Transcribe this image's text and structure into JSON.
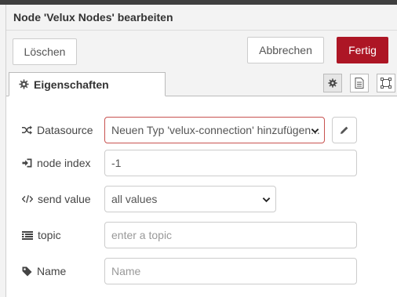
{
  "dialog": {
    "title": "Node 'Velux Nodes' bearbeiten"
  },
  "toolbar": {
    "delete_label": "Löschen",
    "cancel_label": "Abbrechen",
    "done_label": "Fertig"
  },
  "tabs": {
    "properties_label": "Eigenschaften"
  },
  "form": {
    "datasource": {
      "label": "Datasource",
      "value": "Neuen Typ 'velux-connection' hinzufügen..."
    },
    "node_index": {
      "label": "node index",
      "value": "-1"
    },
    "send_value": {
      "label": "send value",
      "value": "all values"
    },
    "topic": {
      "label": "topic",
      "placeholder": "enter a topic"
    },
    "name": {
      "label": "Name",
      "placeholder": "Name"
    }
  },
  "colors": {
    "accent": "#ad1625",
    "invalid_border": "#c85250"
  },
  "icons": [
    "gear-icon",
    "document-icon",
    "frame-icon",
    "shuffle-icon",
    "sign-in-icon",
    "code-icon",
    "list-icon",
    "tag-icon",
    "pencil-icon",
    "chevron-down-icon"
  ]
}
